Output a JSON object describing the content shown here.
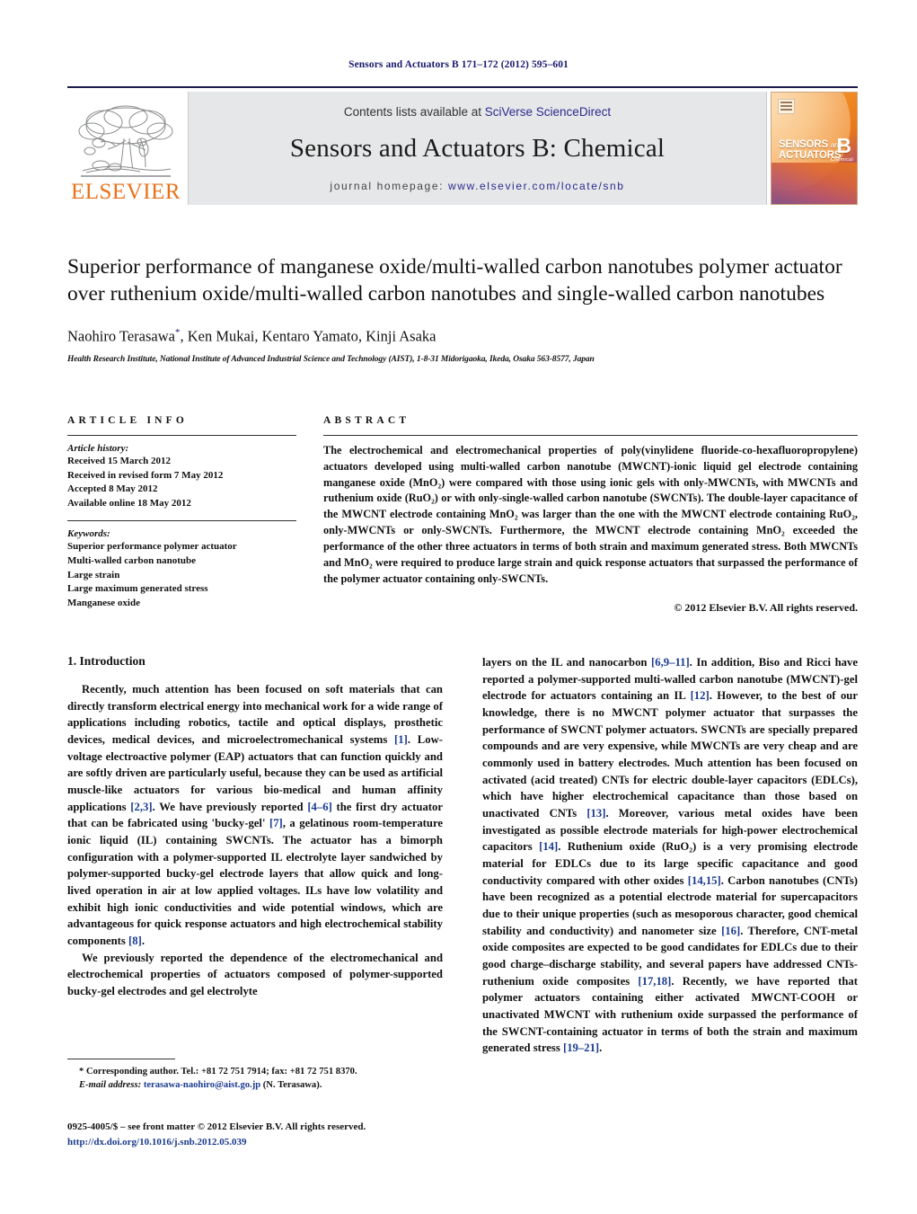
{
  "running_head": "Sensors and Actuators B 171–172 (2012) 595–601",
  "masthead": {
    "publisher_name": "ELSEVIER",
    "contents_prefix": "Contents lists available at ",
    "contents_link": "SciVerse ScienceDirect",
    "journal_title": "Sensors and Actuators B: Chemical",
    "homepage_prefix": "journal homepage: ",
    "homepage_url": "www.elsevier.com/locate/snb",
    "cover": {
      "line1": "SENSORS",
      "line1_small": "and",
      "line2": "ACTUATORS",
      "letter": "B",
      "letter_sub": "Chemical"
    }
  },
  "title": "Superior performance of manganese oxide/multi-walled carbon nanotubes polymer actuator over ruthenium oxide/multi-walled carbon nanotubes and single-walled carbon nanotubes",
  "authors": "Naohiro Terasawa",
  "authors_rest": ", Ken Mukai, Kentaro Yamato, Kinji Asaka",
  "author_marker": "*",
  "affiliation": "Health Research Institute, National Institute of Advanced Industrial Science and Technology (AIST), 1-8-31 Midorigaoka, Ikeda, Osaka 563-8577, Japan",
  "article_info": {
    "heading": "ARTICLE INFO",
    "history_label": "Article history:",
    "history": [
      "Received 15 March 2012",
      "Received in revised form 7 May 2012",
      "Accepted 8 May 2012",
      "Available online 18 May 2012"
    ],
    "keywords_label": "Keywords:",
    "keywords": [
      "Superior performance polymer actuator",
      "Multi-walled carbon nanotube",
      "Large strain",
      "Large maximum generated stress",
      "Manganese oxide"
    ]
  },
  "abstract": {
    "heading": "ABSTRACT",
    "body": "The electrochemical and electromechanical properties of poly(vinylidene fluoride-co-hexafluoropropylene) actuators developed using multi-walled carbon nanotube (MWCNT)-ionic liquid gel electrode containing manganese oxide (MnO₂) were compared with those using ionic gels with only-MWCNTs, with MWCNTs and ruthenium oxide (RuO₂) or with only-single-walled carbon nanotube (SWCNTs). The double-layer capacitance of the MWCNT electrode containing MnO₂ was larger than the one with the MWCNT electrode containing RuO₂, only-MWCNTs or only-SWCNTs. Furthermore, the MWCNT electrode containing MnO₂ exceeded the performance of the other three actuators in terms of both strain and maximum generated stress. Both MWCNTs and MnO₂ were required to produce large strain and quick response actuators that surpassed the performance of the polymer actuator containing only-SWCNTs.",
    "copyright": "© 2012 Elsevier B.V. All rights reserved."
  },
  "introduction": {
    "heading": "1.  Introduction",
    "left_para1_a": "Recently, much attention has been focused on soft materials that can directly transform electrical energy into mechanical work for a wide range of applications including robotics, tactile and optical displays, prosthetic devices, medical devices, and microelectromechanical systems ",
    "left_para1_cit1": "[1]",
    "left_para1_b": ". Low-voltage electroactive polymer (EAP) actuators that can function quickly and are softly driven are particularly useful, because they can be used as artificial muscle-like actuators for various bio-medical and human affinity applications ",
    "left_para1_cit2": "[2,3]",
    "left_para1_c": ". We have previously reported ",
    "left_para1_cit3": "[4–6]",
    "left_para1_d": " the first dry actuator that can be fabricated using 'bucky-gel' ",
    "left_para1_cit4": "[7]",
    "left_para1_e": ", a gelatinous room-temperature ionic liquid (IL) containing SWCNTs. The actuator has a bimorph configuration with a polymer-supported IL electrolyte layer sandwiched by polymer-supported bucky-gel electrode layers that allow quick and long-lived operation in air at low applied voltages. ILs have low volatility and exhibit high ionic conductivities and wide potential windows, which are advantageous for quick response actuators and high electrochemical stability components ",
    "left_para1_cit5": "[8]",
    "left_para1_f": ".",
    "left_para2": "We previously reported the dependence of the electromechanical and electrochemical properties of actuators composed of polymer-supported bucky-gel electrodes and gel electrolyte",
    "right_para_a": "layers on the IL and nanocarbon ",
    "right_cit1": "[6,9–11]",
    "right_b": ". In addition, Biso and Ricci have reported a polymer-supported multi-walled carbon nanotube (MWCNT)-gel electrode for actuators containing an IL ",
    "right_cit2": "[12]",
    "right_c": ". However, to the best of our knowledge, there is no MWCNT polymer actuator that surpasses the performance of SWCNT polymer actuators. SWCNTs are specially prepared compounds and are very expensive, while MWCNTs are very cheap and are commonly used in battery electrodes. Much attention has been focused on activated (acid treated) CNTs for electric double-layer capacitors (EDLCs), which have higher electrochemical capacitance than those based on unactivated CNTs ",
    "right_cit3": "[13]",
    "right_d": ". Moreover, various metal oxides have been investigated as possible electrode materials for high-power electrochemical capacitors ",
    "right_cit4": "[14]",
    "right_e": ". Ruthenium oxide (RuO₂) is a very promising electrode material for EDLCs due to its large specific capacitance and good conductivity compared with other oxides ",
    "right_cit5": "[14,15]",
    "right_f": ". Carbon nanotubes (CNTs) have been recognized as a potential electrode material for supercapacitors due to their unique properties (such as mesoporous character, good chemical stability and conductivity) and nanometer size ",
    "right_cit6": "[16]",
    "right_g": ". Therefore, CNT-metal oxide composites are expected to be good candidates for EDLCs due to their good charge–discharge stability, and several papers have addressed CNTs-ruthenium oxide composites ",
    "right_cit7": "[17,18]",
    "right_h": ". Recently, we have reported that polymer actuators containing either activated MWCNT-COOH or unactivated MWCNT with ruthenium oxide surpassed the performance of the SWCNT-containing actuator in terms of both the strain and maximum generated stress ",
    "right_cit8": "[19–21]",
    "right_i": "."
  },
  "footnotes": {
    "corresponding": "* Corresponding author. Tel.: +81 72 751 7914; fax: +81 72 751 8370.",
    "email_label": "E-mail address:",
    "email": "terasawa-naohiro@aist.go.jp",
    "email_suffix": "(N. Terasawa)."
  },
  "footer": {
    "issn_line": "0925-4005/$ – see front matter © 2012 Elsevier B.V. All rights reserved.",
    "doi": "http://dx.doi.org/10.1016/j.snb.2012.05.039"
  },
  "colors": {
    "link_blue": "#2b2b8f",
    "citation_blue": "#1a3a8f",
    "elsevier_orange": "#E9711C",
    "band_grey": "#e6e7e8"
  }
}
